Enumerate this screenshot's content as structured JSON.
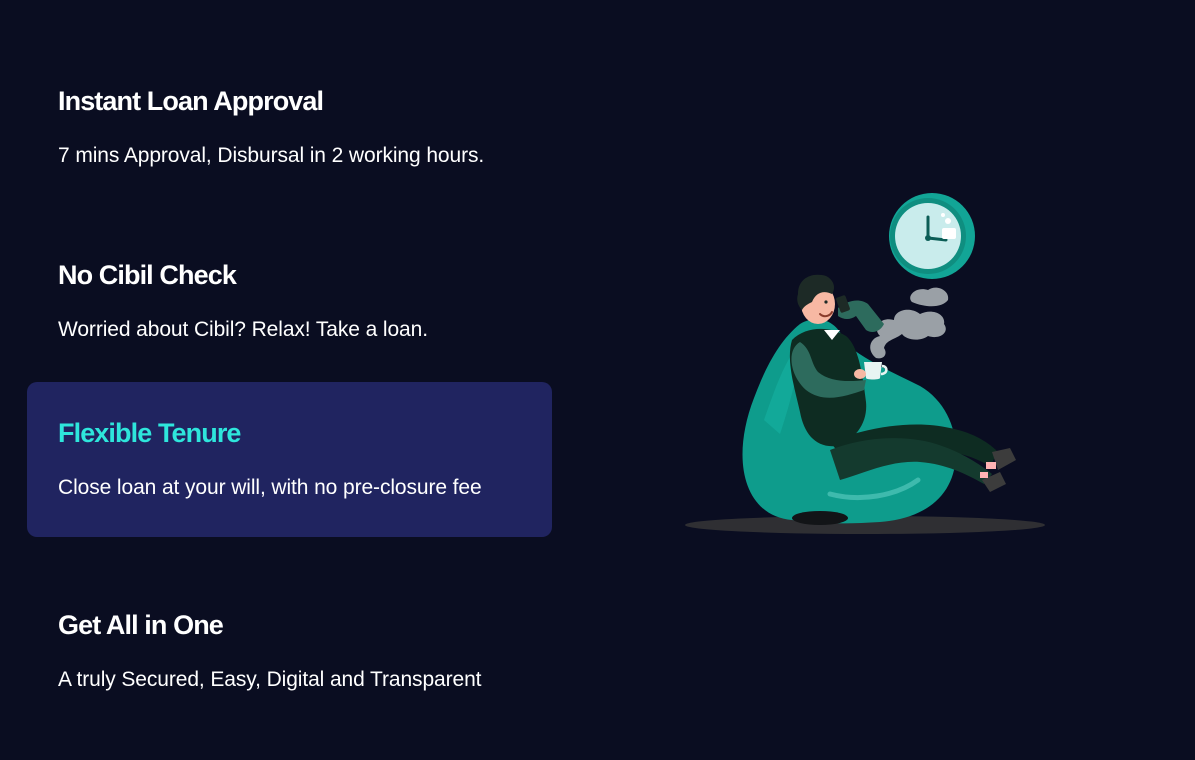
{
  "features": [
    {
      "title": "Instant Loan Approval",
      "description": "7 mins Approval, Disbursal in 2 working hours.",
      "active": false
    },
    {
      "title": "No Cibil Check",
      "description": "Worried about Cibil? Relax! Take a loan.",
      "active": false
    },
    {
      "title": "Flexible Tenure",
      "description": "Close loan at your will, with no pre-closure fee",
      "active": true
    },
    {
      "title": "Get All in One",
      "description": "A truly Secured, Easy, Digital and Transparent",
      "active": false
    }
  ],
  "colors": {
    "background": "#0a0d21",
    "active_card": "#202460",
    "active_title": "#2ee6dc",
    "text": "#ffffff",
    "accent_teal": "#0e9c8c"
  },
  "illustration": {
    "icon": "man-relaxing-in-beanbag-with-clock-icon"
  }
}
